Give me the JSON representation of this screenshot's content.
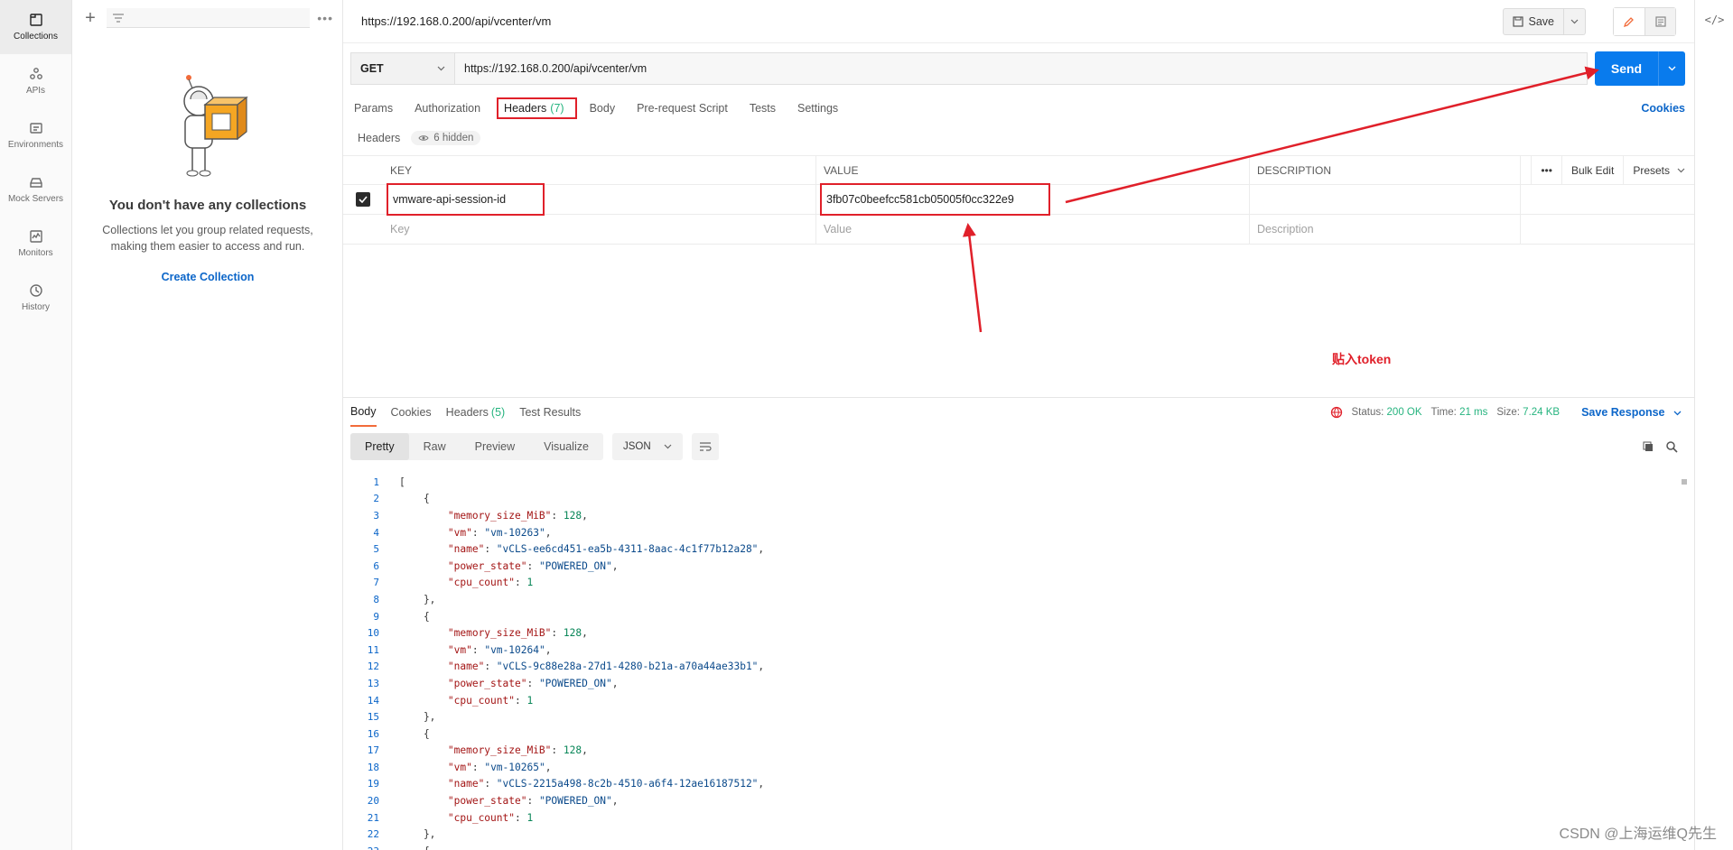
{
  "rail": {
    "items": [
      {
        "label": "Collections",
        "icon": "collections-icon",
        "active": true
      },
      {
        "label": "APIs",
        "icon": "apis-icon"
      },
      {
        "label": "Environments",
        "icon": "environments-icon"
      },
      {
        "label": "Mock Servers",
        "icon": "mock-servers-icon"
      },
      {
        "label": "Monitors",
        "icon": "monitors-icon"
      },
      {
        "label": "History",
        "icon": "history-icon"
      }
    ]
  },
  "sidebar": {
    "empty_title": "You don't have any collections",
    "empty_desc": "Collections let you group related requests, making them easier to access and run.",
    "create_link": "Create Collection"
  },
  "request": {
    "title": "https://192.168.0.200/api/vcenter/vm",
    "save_label": "Save",
    "method": "GET",
    "url": "https://192.168.0.200/api/vcenter/vm",
    "send_label": "Send",
    "tabs": {
      "params": "Params",
      "authorization": "Authorization",
      "headers": "Headers",
      "headers_count": "(7)",
      "body": "Body",
      "prerequest": "Pre-request Script",
      "tests": "Tests",
      "settings": "Settings"
    },
    "cookies_label": "Cookies",
    "headers_sub": "Headers",
    "hidden_label": "6 hidden",
    "table": {
      "col_key": "KEY",
      "col_value": "VALUE",
      "col_desc": "DESCRIPTION",
      "more": "•••",
      "bulk_edit": "Bulk Edit",
      "presets": "Presets",
      "row_key": "vmware-api-session-id",
      "row_value": "3fb07c0beefcc581cb05005f0cc322e9",
      "ph_key": "Key",
      "ph_value": "Value",
      "ph_desc": "Description"
    }
  },
  "annotation": {
    "text": "贴入token",
    "color": "#e0202a"
  },
  "response": {
    "tabs": {
      "body": "Body",
      "cookies": "Cookies",
      "headers": "Headers",
      "headers_count": "(5)",
      "test_results": "Test Results"
    },
    "status_label": "Status:",
    "status_value": "200 OK",
    "time_label": "Time:",
    "time_value": "21 ms",
    "size_label": "Size:",
    "size_value": "7.24 KB",
    "save_response": "Save Response",
    "views": {
      "pretty": "Pretty",
      "raw": "Raw",
      "preview": "Preview",
      "visualize": "Visualize"
    },
    "format": "JSON",
    "lines": [
      "[",
      "    {",
      "        \"memory_size_MiB\": 128,",
      "        \"vm\": \"vm-10263\",",
      "        \"name\": \"vCLS-ee6cd451-ea5b-4311-8aac-4c1f77b12a28\",",
      "        \"power_state\": \"POWERED_ON\",",
      "        \"cpu_count\": 1",
      "    },",
      "    {",
      "        \"memory_size_MiB\": 128,",
      "        \"vm\": \"vm-10264\",",
      "        \"name\": \"vCLS-9c88e28a-27d1-4280-b21a-a70a44ae33b1\",",
      "        \"power_state\": \"POWERED_ON\",",
      "        \"cpu_count\": 1",
      "    },",
      "    {",
      "        \"memory_size_MiB\": 128,",
      "        \"vm\": \"vm-10265\",",
      "        \"name\": \"vCLS-2215a498-8c2b-4510-a6f4-12ae16187512\",",
      "        \"power_state\": \"POWERED_ON\",",
      "        \"cpu_count\": 1",
      "    },",
      "    {"
    ]
  },
  "watermark": "CSDN @上海运维Q先生",
  "colors": {
    "accent": "#097bed",
    "annotation": "#e0202a",
    "success": "#26b47f",
    "link": "#0c66c9"
  }
}
